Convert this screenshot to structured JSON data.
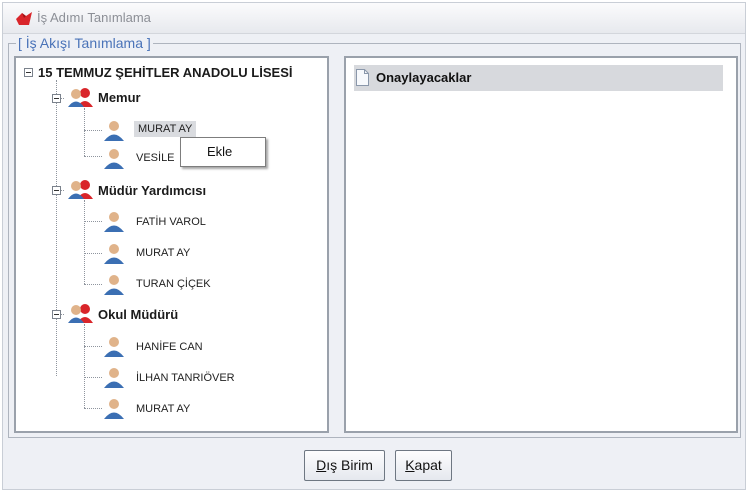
{
  "window": {
    "title": "İş Adımı Tanımlama"
  },
  "workflow": {
    "legend": "[ İş Akışı Tanımlama ]",
    "tree": {
      "root": "15 TEMMUZ ŞEHİTLER ANADOLU LİSESİ",
      "groups": [
        {
          "label": "Memur",
          "users": [
            "MURAT AY",
            "VESİLE"
          ]
        },
        {
          "label": "Müdür Yardımcısı",
          "users": [
            "FATİH VAROL",
            "MURAT AY",
            "TURAN ÇİÇEK"
          ]
        },
        {
          "label": "Okul Müdürü",
          "users": [
            "HANİFE CAN",
            "İLHAN TANRIÖVER",
            "MURAT AY"
          ]
        }
      ]
    },
    "context_menu": {
      "item": "Ekle"
    },
    "approvers": {
      "header": "Onaylayacaklar"
    }
  },
  "buttons": {
    "dis_birim": {
      "mnemonic": "D",
      "rest": "ış Birim"
    },
    "kapat": {
      "mnemonic": "K",
      "rest": "apat"
    }
  },
  "colors": {
    "legend": "#4a73b8",
    "icon_red": "#d9252a",
    "icon_blue": "#3b6fb3",
    "selection": "#d9dbdf"
  }
}
